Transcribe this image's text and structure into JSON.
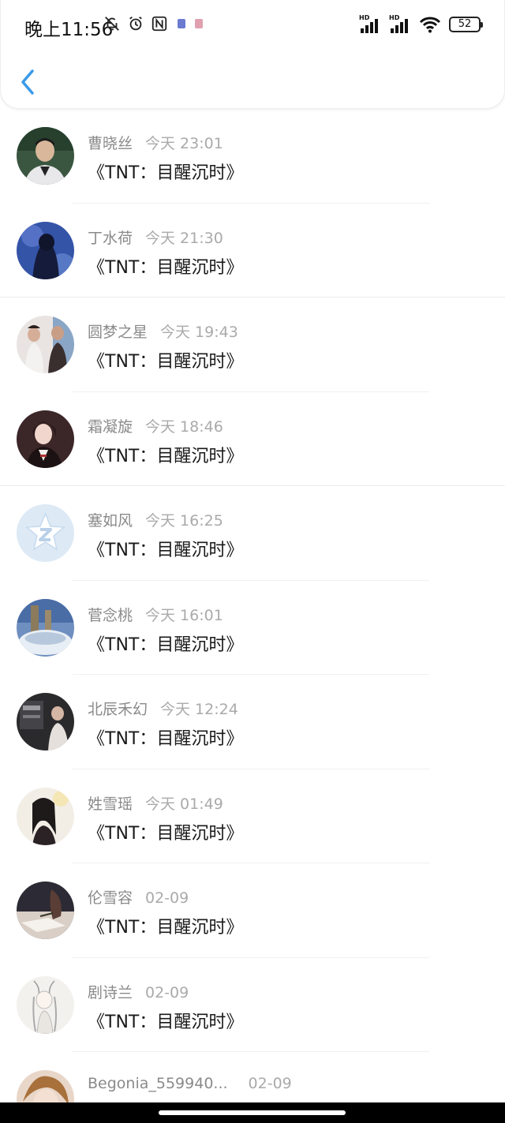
{
  "status_bar": {
    "time": "晚上11:56",
    "battery": "52",
    "network_label": "HD"
  },
  "colors": {
    "accent": "#3a9ae8",
    "name_text": "#8a8a8a",
    "time_text": "#aaaaaa",
    "title_text": "#1a1a1a"
  },
  "items": [
    {
      "name": "曹晓丝",
      "time": "今天 23:01",
      "title": "《TNT：目醒沉时》"
    },
    {
      "name": "丁水荷",
      "time": "今天 21:30",
      "title": "《TNT：目醒沉时》"
    },
    {
      "name": "圆梦之星",
      "time": "今天 19:43",
      "title": "《TNT：目醒沉时》"
    },
    {
      "name": "霜凝旋",
      "time": "今天 18:46",
      "title": "《TNT：目醒沉时》"
    },
    {
      "name": "塞如风",
      "time": "今天 16:25",
      "title": "《TNT：目醒沉时》"
    },
    {
      "name": "菅念桃",
      "time": "今天 16:01",
      "title": "《TNT：目醒沉时》"
    },
    {
      "name": "北辰禾幻",
      "time": "今天 12:24",
      "title": "《TNT：目醒沉时》"
    },
    {
      "name": "姓雪瑶",
      "time": "今天 01:49",
      "title": "《TNT：目醒沉时》"
    },
    {
      "name": "伦雪容",
      "time": "02-09",
      "title": "《TNT：目醒沉时》"
    },
    {
      "name": "剧诗兰",
      "time": "02-09",
      "title": "《TNT：目醒沉时》"
    },
    {
      "name": "Begonia_559940...",
      "time": "02-09",
      "title": ""
    }
  ]
}
